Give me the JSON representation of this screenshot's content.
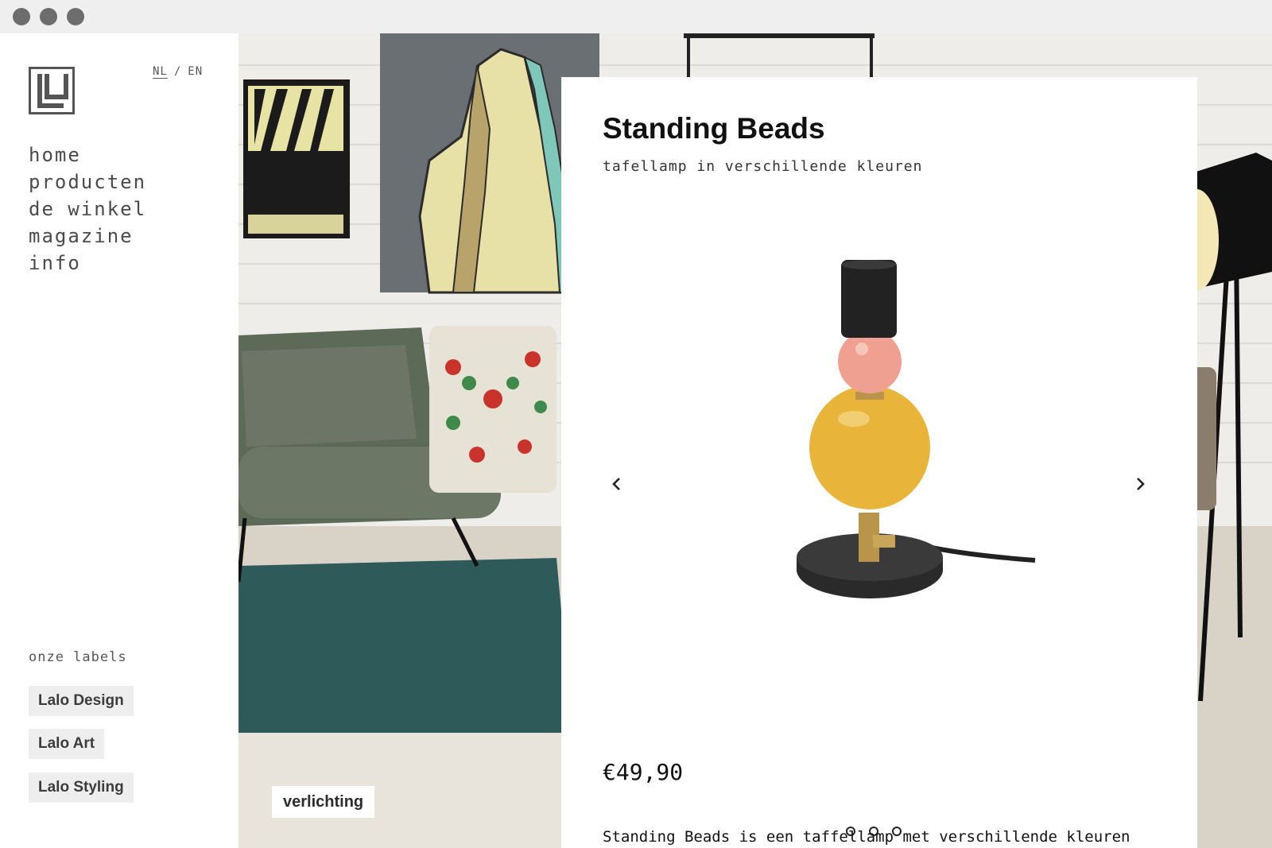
{
  "window": {
    "controls": [
      "close",
      "minimize",
      "maximize"
    ]
  },
  "sidebar": {
    "logo": "lalo-logo-icon",
    "lang": {
      "nl": "NL",
      "separator": "/",
      "en": "EN"
    },
    "nav": [
      {
        "label": "home"
      },
      {
        "label": "producten"
      },
      {
        "label": "de winkel"
      },
      {
        "label": "magazine"
      },
      {
        "label": "info"
      }
    ],
    "labels_title": "onze labels",
    "labels": [
      {
        "label": "Lalo Design"
      },
      {
        "label": "Lalo Art"
      },
      {
        "label": "Lalo Styling"
      }
    ]
  },
  "hero": {
    "category": "verlichting"
  },
  "product": {
    "title": "Standing Beads",
    "subtitle": "tafellamp in verschillende kleuren",
    "price": "€49,90",
    "description": "Standing Beads is een taffellamp met verschillende kleuren",
    "carousel": {
      "slides": 3,
      "active": 1,
      "prev_icon": "chevron-left-icon",
      "next_icon": "chevron-right-icon"
    }
  },
  "colors": {
    "accent": "#111111",
    "tag_bg": "#eeeeee",
    "lamp_yellow": "#e8b53a",
    "lamp_pink": "#f0a090"
  }
}
